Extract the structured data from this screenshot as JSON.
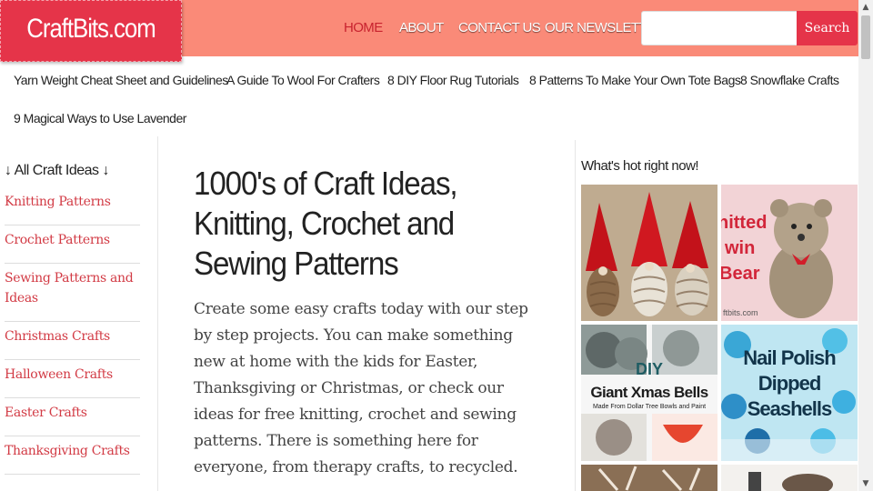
{
  "site": {
    "logo_text": "CraftBits.com"
  },
  "topnav": [
    {
      "label": "HOME",
      "active": true
    },
    {
      "label": "ABOUT",
      "active": false
    },
    {
      "label": "CONTACT US",
      "active": false
    },
    {
      "label": "OUR NEWSLETTER",
      "active": false
    }
  ],
  "search": {
    "button_label": "Search",
    "placeholder": "",
    "value": ""
  },
  "subnav": [
    "Yarn Weight Cheat Sheet and Guidelines",
    "A Guide To Wool For Crafters",
    "8 DIY Floor Rug Tutorials",
    "8 Patterns To Make Your Own Tote Bags",
    "8 Snowflake Crafts",
    "9 Magical Ways to Use Lavender"
  ],
  "sidebar": {
    "title": "↓ All Craft Ideas ↓",
    "items": [
      "Knitting Patterns",
      "Crochet Patterns",
      "Sewing Patterns and Ideas",
      "Christmas Crafts",
      "Halloween Crafts",
      "Easter Crafts",
      "Thanksgiving Crafts"
    ]
  },
  "main": {
    "title": "1000's of Craft Ideas, Knitting, Crochet and Sewing Patterns",
    "intro": "Create some easy crafts today with our step by step projects. You can make something new at home with the kids for Easter, Thanksgiving or Christmas, or check our ideas for free knitting, crochet and sewing patterns. There is something here for everyone, from therapy crafts, to recycled."
  },
  "hot": {
    "title": "What's hot right now!",
    "thumbs": [
      {
        "name": "pinecone-gnomes-image",
        "caption": ""
      },
      {
        "name": "knitted-twin-bear-image",
        "caption_lines": [
          "nitted",
          "win",
          "Bear"
        ],
        "footer": "ftbits.com"
      },
      {
        "name": "giant-xmas-bells-image",
        "caption_lines": [
          "DIY",
          "Giant Xmas Bells",
          "Made From Dollar Tree Bowls and Paint"
        ]
      },
      {
        "name": "nail-polish-seashells-image",
        "caption_lines": [
          "Nail Polish",
          "Dipped",
          "Seashells"
        ]
      }
    ]
  },
  "colors": {
    "header": "#fa8a78",
    "brand": "#e53449",
    "link": "#d23a44",
    "active_nav": "#c8232f"
  }
}
